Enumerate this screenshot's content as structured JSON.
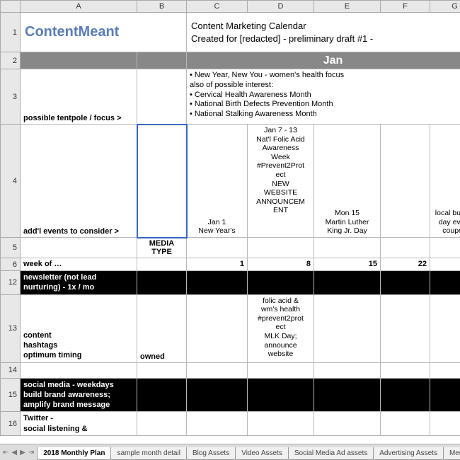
{
  "columns": [
    "A",
    "B",
    "C",
    "D",
    "E",
    "F",
    "G"
  ],
  "rows": [
    "1",
    "2",
    "3",
    "4",
    "5",
    "6",
    "12",
    "13",
    "14",
    "15",
    "16"
  ],
  "brand": "ContentMeant",
  "title_line1": "Content Marketing Calendar",
  "title_line2": "Created for [redacted] - preliminary draft #1 -",
  "month": "Jan",
  "tentpole_label": "possible tentpole /  focus >",
  "tentpole_text": "• New Year, New You - women's health focus\nalso of possible interest:\n• Cervical Health Awareness Month\n• National Birth Defects Prevention Month\n• National Stalking Awareness Month",
  "addl_events_label": "add'l events to consider >",
  "events": {
    "c": "Jan 1\nNew Year's",
    "d": "Jan 7 - 13\nNat'l Folic Acid\nAwareness\nWeek\n#Prevent2Prot\nect\nNEW\nWEBSITE\nANNOUNCEM\nENT",
    "e": "Mon 15\nMartin Luther\nKing Jr. Day",
    "g": "local busine\nday event\ncoupon"
  },
  "media_type": "MEDIA TYPE",
  "week_of": "week of …",
  "week_nums": {
    "c": "1",
    "d": "8",
    "e": "15",
    "f": "22"
  },
  "newsletter_label": "newsletter (not lead\nnurturing) - 1x / mo",
  "row13": {
    "a": "content\nhashtags\noptimum timing",
    "b": "owned",
    "d": "folic acid &\nwm's health\n#prevent2prot\nect\nMLK Day;\nannounce\nwebsite"
  },
  "row15_label": "social media - weekdays\nbuild brand awareness;\namplify brand message",
  "row16_label": "Twitter -\nsocial listening &",
  "tabs": [
    "2018 Monthly Plan",
    "sample month detail",
    "Blog Assets",
    "Video Assets",
    "Social Media Ad assets",
    "Advertising Assets",
    "Med"
  ],
  "active_tab": 0
}
